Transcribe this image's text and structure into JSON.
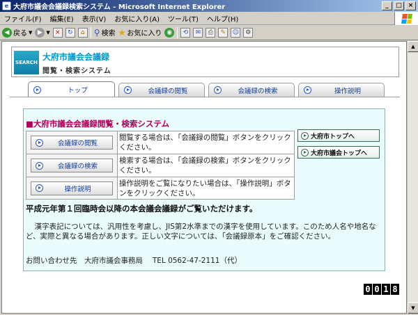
{
  "window": {
    "title": "大府市議会会議録検索システム - Microsoft Internet Explorer",
    "buttons": [
      "_",
      "□",
      "×"
    ]
  },
  "menu": [
    "ファイル(F)",
    "編集(E)",
    "表示(V)",
    "お気に入り(A)",
    "ツール(T)",
    "ヘルプ(H)"
  ],
  "toolbar": {
    "back": "戻る",
    "search": "検索",
    "favorites": "お気に入り"
  },
  "header": {
    "logo_text": "SEARCH",
    "title": "大府市議会会議録",
    "subtitle": "閲覧・検索システム"
  },
  "tabs": [
    {
      "label": "トップ",
      "active": true
    },
    {
      "label": "会議録の閲覧",
      "active": false
    },
    {
      "label": "会議録の検索",
      "active": false
    },
    {
      "label": "操作説明",
      "active": false
    }
  ],
  "main": {
    "heading": "■大府市議会会議録閲覧・検索システム",
    "rows": [
      {
        "button": "会議録の閲覧",
        "desc": "閲覧する場合は、「会議録の閲覧」ボタンをクリックください。"
      },
      {
        "button": "会議録の検索",
        "desc": "検索する場合は、「会議録の検索」ボタンをクリックください。"
      },
      {
        "button": "操作説明",
        "desc": "操作説明をご覧になりたい場合は、「操作説明」ボタンをクリックください。"
      }
    ],
    "side_buttons": [
      "大府市トップへ",
      "大府市議会トップへ"
    ],
    "notice": "平成元年第１回臨時会以降の本会議会議録がご覧いただけます。",
    "kanji_note": "漢字表記については、汎用性を考慮し、JIS第2水準までの漢字を使用しています。このため人名や地名など、実際と異なる場合があります。正しい文字については、「会議録原本」をご確認ください。",
    "contact": "お問い合わせ先　大府市議会事務局　 TEL 0562-47-2111（代）"
  },
  "counter": [
    "0",
    "0",
    "1",
    "8"
  ]
}
